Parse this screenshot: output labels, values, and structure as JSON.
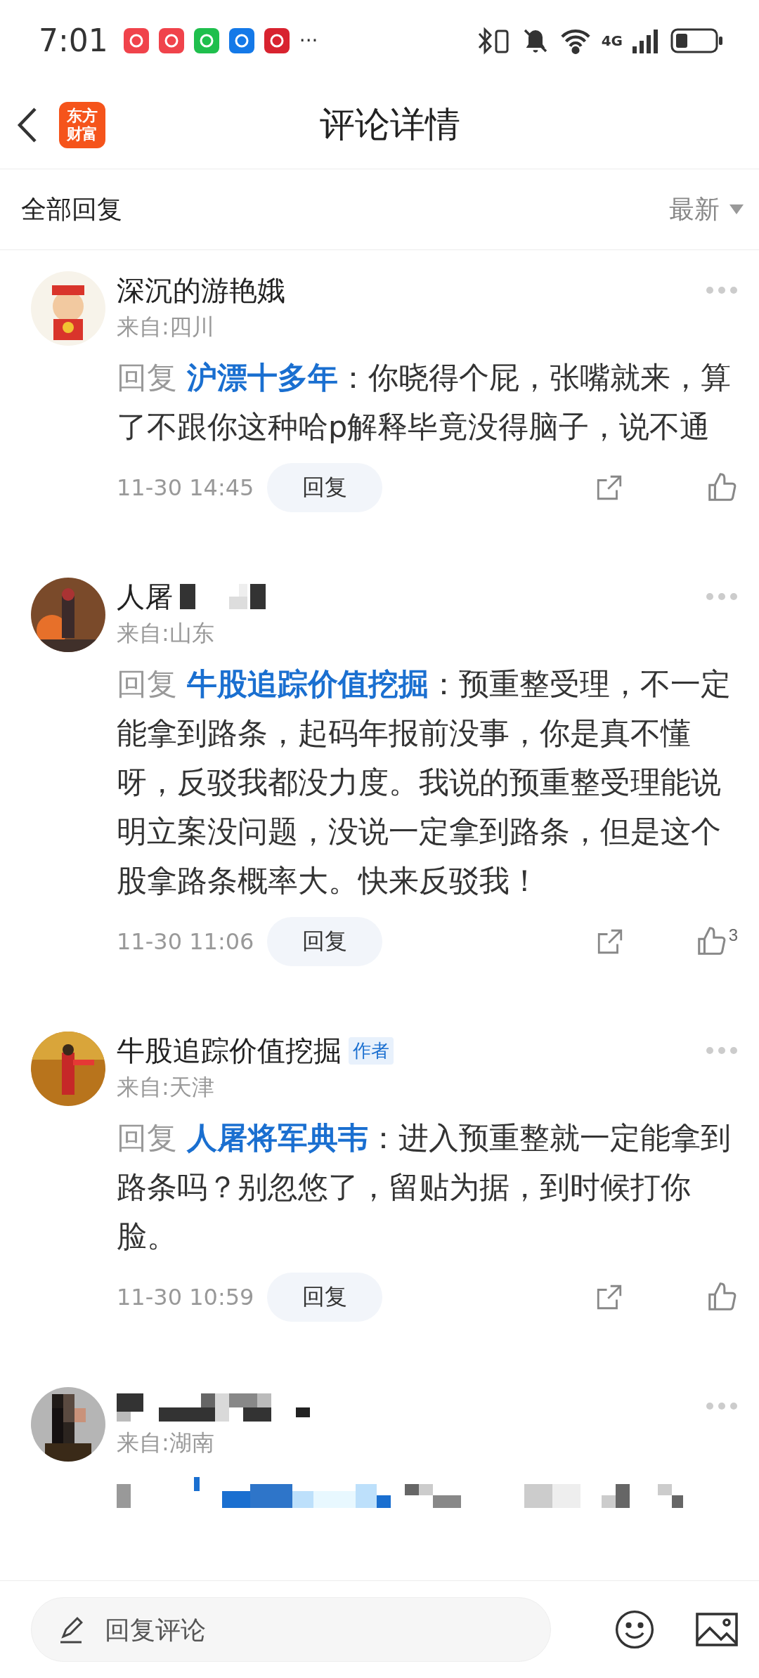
{
  "status_bar": {
    "time": "7:01",
    "more": "···",
    "network": "4G"
  },
  "header": {
    "logo_lines": [
      "东方",
      "财富"
    ],
    "title": "评论详情"
  },
  "sort_bar": {
    "label": "全部回复",
    "sort": "最新"
  },
  "comments": [
    {
      "kind": "normal",
      "name": "深沉的游艳娥",
      "location": "来自:四川",
      "reply_prefix": "回复",
      "reply_to": "沪漂十多年",
      "text": "：你晓得个屁，张嘴就来，算了不跟你这种哈p解释毕竟没得脑子，说不通",
      "time": "11-30 14:45",
      "reply_button": "回复"
    },
    {
      "kind": "partial_mosaic",
      "name": "人屠",
      "location": "来自:山东",
      "reply_prefix": "回复",
      "reply_to": "牛股追踪价值挖掘",
      "text": "：预重整受理，不一定能拿到路条，起码年报前没事，你是真不懂呀，反驳我都没力度。我说的预重整受理能说明立案没问题，没说一定拿到路条，但是这个股拿路条概率大。快来反驳我！",
      "time": "11-30 11:06",
      "reply_button": "回复",
      "like_count": "3"
    },
    {
      "kind": "normal",
      "name": "牛股追踪价值挖掘",
      "author_badge": "作者",
      "location": "来自:天津",
      "reply_prefix": "回复",
      "reply_to": "人屠将军典韦",
      "text": "：进入预重整就一定能拿到路条吗？别忽悠了，留贴为据，到时候打你脸。",
      "time": "11-30 10:59",
      "reply_button": "回复"
    },
    {
      "kind": "mosaic",
      "location": "来自:湖南"
    }
  ],
  "composer": {
    "placeholder": "回复评论"
  }
}
